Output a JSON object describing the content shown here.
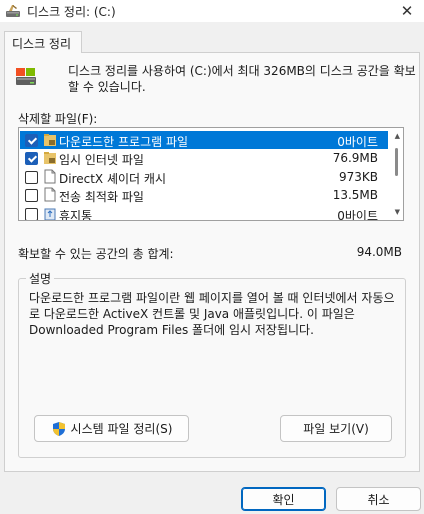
{
  "window": {
    "title": "디스크 정리: (C:)",
    "close_glyph": "✕"
  },
  "tab": {
    "label": "디스크 정리"
  },
  "intro": "디스크 정리를 사용하여 (C:)에서 최대 326MB의 디스크 공간을 확보할 수 있습니다.",
  "files_to_delete": {
    "label": "삭제할 파일(F):",
    "items": [
      {
        "name": "다운로드한 프로그램 파일",
        "size": "0바이트",
        "checked": true,
        "selected": true,
        "icon": "folder-lock-icon"
      },
      {
        "name": "임시 인터넷 파일",
        "size": "76.9MB",
        "checked": true,
        "selected": false,
        "icon": "folder-lock-icon"
      },
      {
        "name": "DirectX 셰이더 캐시",
        "size": "973KB",
        "checked": false,
        "selected": false,
        "icon": "document-icon"
      },
      {
        "name": "전송 최적화 파일",
        "size": "13.5MB",
        "checked": false,
        "selected": false,
        "icon": "document-icon"
      },
      {
        "name": "휴지통",
        "size": "0바이트",
        "checked": false,
        "selected": false,
        "icon": "recycle-bin-icon"
      }
    ]
  },
  "total": {
    "label": "확보할 수 있는 공간의 총 합계:",
    "value": "94.0MB"
  },
  "description": {
    "title": "설명",
    "text": "다운로드한 프로그램 파일이란 웹 페이지를 열어 볼 때 인터넷에서 자동으로 다운로드한 ActiveX 컨트롤 및 Java 애플릿입니다. 이 파일은 Downloaded Program Files 폴더에 임시 저장됩니다."
  },
  "buttons": {
    "cleanup_system": "시스템 파일 정리(S)",
    "view_files": "파일 보기(V)",
    "ok": "확인",
    "cancel": "취소"
  },
  "colors": {
    "selection": "#0078d7",
    "checkbox": "#1c5fb8",
    "primary_border": "#0067c0"
  }
}
